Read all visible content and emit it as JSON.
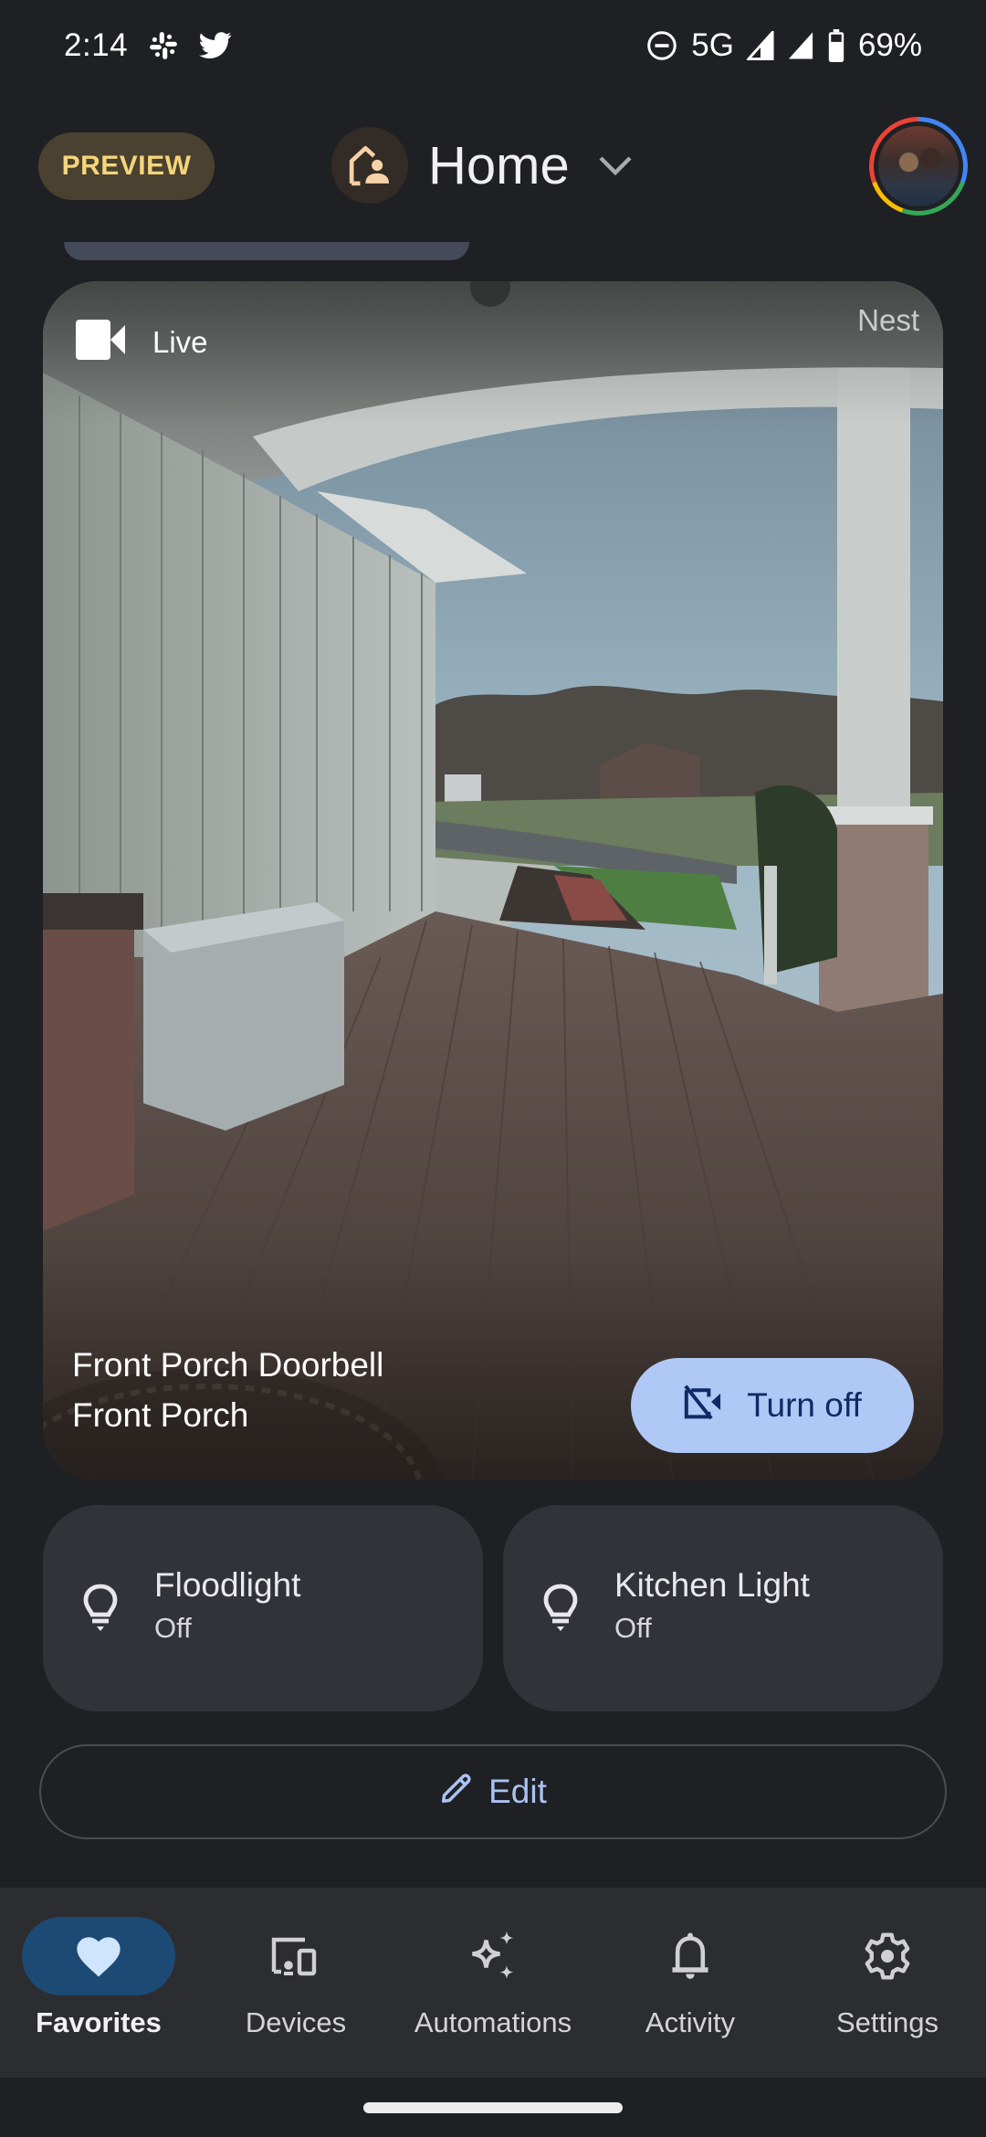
{
  "status_bar": {
    "time": "2:14",
    "notification_icons": [
      "slack-icon",
      "twitter-icon"
    ],
    "network": "5G",
    "battery": "69%",
    "status_icons": [
      "do-not-disturb-icon",
      "signal-icon",
      "signal-icon",
      "battery-icon"
    ]
  },
  "header": {
    "preview_label": "PREVIEW",
    "home_icon": "home-person-icon",
    "home_name": "Home",
    "dropdown_icon": "chevron-down-icon",
    "avatar_icon": "account-avatar"
  },
  "camera_card": {
    "live_icon": "videocam-icon",
    "live_label": "Live",
    "brand_label": "Nest",
    "device_name": "Front Porch Doorbell",
    "room_name": "Front Porch",
    "turn_off_icon": "videocam-off-icon",
    "turn_off_label": "Turn off"
  },
  "tiles": [
    {
      "icon": "lightbulb-icon",
      "name": "Floodlight",
      "state": "Off"
    },
    {
      "icon": "lightbulb-icon",
      "name": "Kitchen Light",
      "state": "Off"
    }
  ],
  "edit_button": {
    "icon": "pencil-icon",
    "label": "Edit"
  },
  "bottom_nav": {
    "active": "Favorites",
    "items": [
      {
        "icon": "heart-icon",
        "label": "Favorites"
      },
      {
        "icon": "devices-icon",
        "label": "Devices"
      },
      {
        "icon": "sparkle-icon",
        "label": "Automations"
      },
      {
        "icon": "bell-icon",
        "label": "Activity"
      },
      {
        "icon": "gear-icon",
        "label": "Settings"
      }
    ]
  },
  "colors": {
    "background": "#1f2024",
    "preview_chip_bg": "#4a4130",
    "preview_chip_text": "#f5d57a",
    "turn_off_bg": "#b0c8f5",
    "turn_off_text": "#112a66",
    "tile_bg": "#323338",
    "edit_text": "#a9c3f2",
    "nav_bg": "#2c2d31",
    "nav_active_pill": "#1c4a75"
  }
}
